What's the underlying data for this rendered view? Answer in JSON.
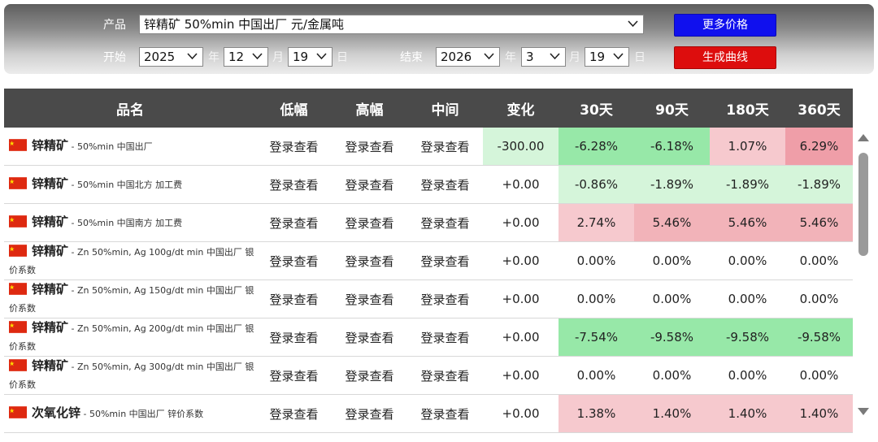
{
  "controls": {
    "product_label": "产品",
    "product_value": "锌精矿 50%min 中国出厂 元/金属吨",
    "more_price_button": "更多价格",
    "start_label": "开始",
    "start_year": "2025",
    "start_month": "12",
    "start_day": "19",
    "end_label": "结束",
    "end_year": "2026",
    "end_month": "3",
    "end_day": "19",
    "year_unit": "年",
    "month_unit": "月",
    "day_unit": "日",
    "generate_curve_button": "生成曲线"
  },
  "table": {
    "headers": [
      "品名",
      "低幅",
      "高幅",
      "中间",
      "变化",
      "30天",
      "90天",
      "180天",
      "360天"
    ],
    "login_text": "登录查看",
    "rows": [
      {
        "name": "锌精矿",
        "desc": "50%min 中国出厂",
        "change": "-300.00",
        "d30": "-6.28%",
        "d90": "-6.18%",
        "d180": "1.07%",
        "d360": "6.29%"
      },
      {
        "name": "锌精矿",
        "desc": "50%min 中国北方 加工费",
        "change": "+0.00",
        "d30": "-0.86%",
        "d90": "-1.89%",
        "d180": "-1.89%",
        "d360": "-1.89%"
      },
      {
        "name": "锌精矿",
        "desc": "50%min 中国南方 加工费",
        "change": "+0.00",
        "d30": "2.74%",
        "d90": "5.46%",
        "d180": "5.46%",
        "d360": "5.46%"
      },
      {
        "name": "锌精矿",
        "desc": "Zn 50%min, Ag 100g/dt min 中国出厂 银价系数",
        "change": "+0.00",
        "d30": "0.00%",
        "d90": "0.00%",
        "d180": "0.00%",
        "d360": "0.00%"
      },
      {
        "name": "锌精矿",
        "desc": "Zn 50%min, Ag 150g/dt min 中国出厂 银价系数",
        "change": "+0.00",
        "d30": "0.00%",
        "d90": "0.00%",
        "d180": "0.00%",
        "d360": "0.00%"
      },
      {
        "name": "锌精矿",
        "desc": "Zn 50%min, Ag 200g/dt min 中国出厂 银价系数",
        "change": "+0.00",
        "d30": "-7.54%",
        "d90": "-9.58%",
        "d180": "-9.58%",
        "d360": "-9.58%"
      },
      {
        "name": "锌精矿",
        "desc": "Zn 50%min, Ag 300g/dt min 中国出厂 银价系数",
        "change": "+0.00",
        "d30": "0.00%",
        "d90": "0.00%",
        "d180": "0.00%",
        "d360": "0.00%"
      },
      {
        "name": "次氧化锌",
        "desc": "50%min 中国出厂 锌价系数",
        "change": "+0.00",
        "d30": "1.38%",
        "d90": "1.40%",
        "d180": "1.40%",
        "d360": "1.40%"
      }
    ]
  },
  "colors": {
    "header_bg": "#4a4a4a",
    "light_green": "#d5f5da",
    "green": "#97e8a8",
    "light_red": "#f6c9ce",
    "red": "#ef9ea8",
    "blue_button": "#1010ee",
    "red_button": "#dd0d0d"
  }
}
